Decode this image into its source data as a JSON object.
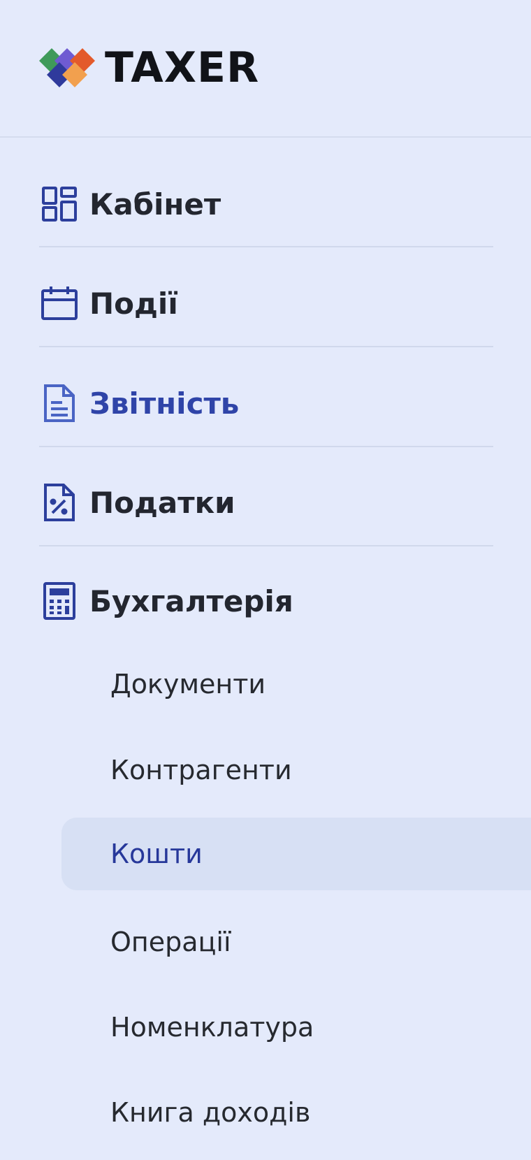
{
  "brand": {
    "name": "TAXER",
    "colors": [
      "#3f9a5a",
      "#6f5bd2",
      "#e35a2b",
      "#2f3a9c",
      "#f2a04e"
    ]
  },
  "nav": {
    "items": [
      {
        "label": "Кабінет",
        "icon": "dashboard-icon"
      },
      {
        "label": "Події",
        "icon": "calendar-icon"
      },
      {
        "label": "Звітність",
        "icon": "document-icon",
        "active": true
      },
      {
        "label": "Податки",
        "icon": "tax-percent-icon"
      },
      {
        "label": "Бухгалтерія",
        "icon": "calculator-icon",
        "expanded": true
      }
    ],
    "sub_items": [
      {
        "label": "Документи"
      },
      {
        "label": "Контрагенти"
      },
      {
        "label": "Кошти",
        "selected": true
      },
      {
        "label": "Операції"
      },
      {
        "label": "Номенклатура"
      },
      {
        "label": "Книга доходів"
      }
    ]
  },
  "colors": {
    "background": "#e4eafb",
    "accent": "#2f44a8",
    "icon": "#2c3f9c",
    "selected_bg": "#d7e0f4"
  }
}
